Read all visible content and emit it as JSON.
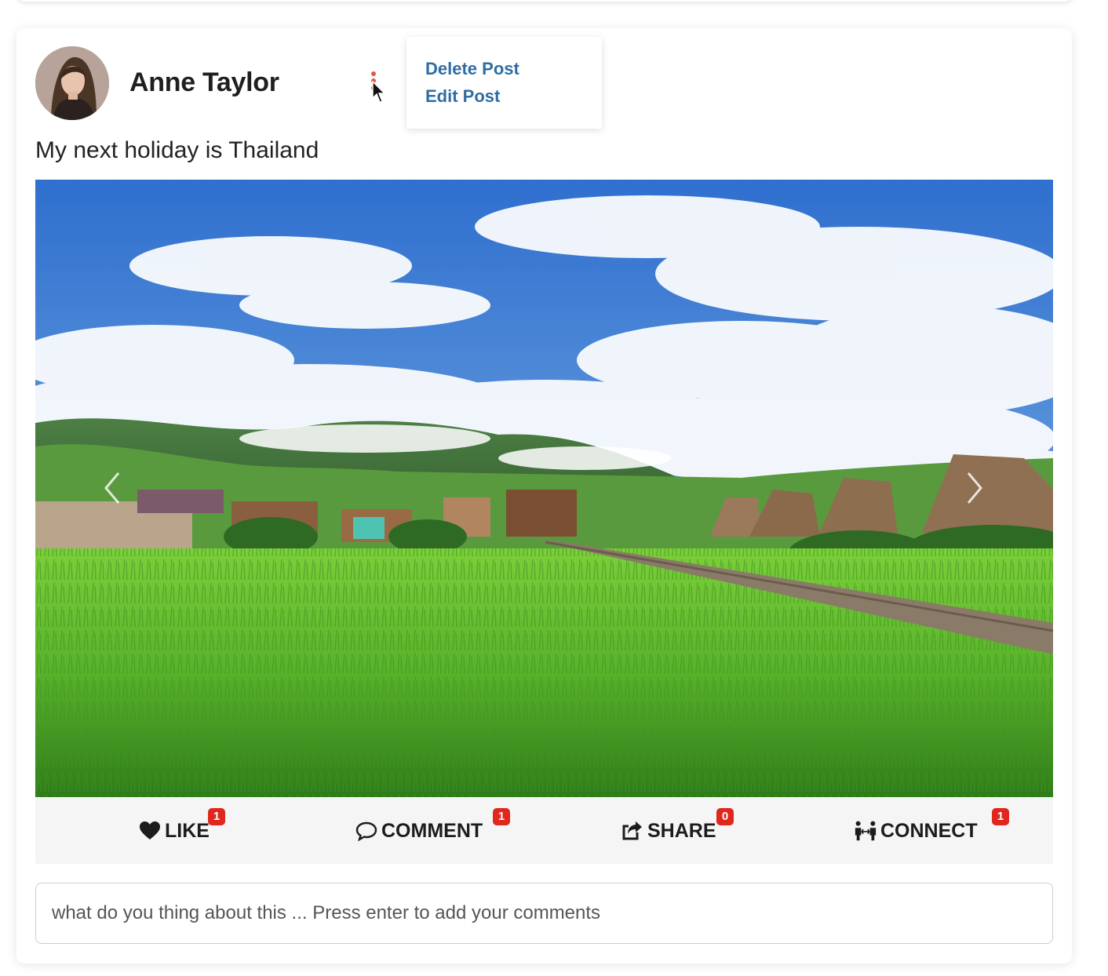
{
  "post": {
    "author": "Anne Taylor",
    "text": "My next holiday is Thailand",
    "menu": {
      "delete_label": "Delete Post",
      "edit_label": "Edit Post"
    }
  },
  "actions": {
    "like": {
      "label": "LIKE",
      "count": "1",
      "icon": "heart-icon"
    },
    "comment": {
      "label": "COMMENT",
      "count": "1",
      "icon": "speech-bubble-icon"
    },
    "share": {
      "label": "SHARE",
      "count": "0",
      "icon": "share-square-icon"
    },
    "connect": {
      "label": "CONNECT",
      "count": "1",
      "icon": "people-connect-icon"
    }
  },
  "comment_box": {
    "placeholder": "what do you thing about this ... Press enter to add your comments"
  },
  "colors": {
    "link": "#2e6da4",
    "badge": "#e0271d",
    "kebab_dot": "#e05a3a"
  }
}
